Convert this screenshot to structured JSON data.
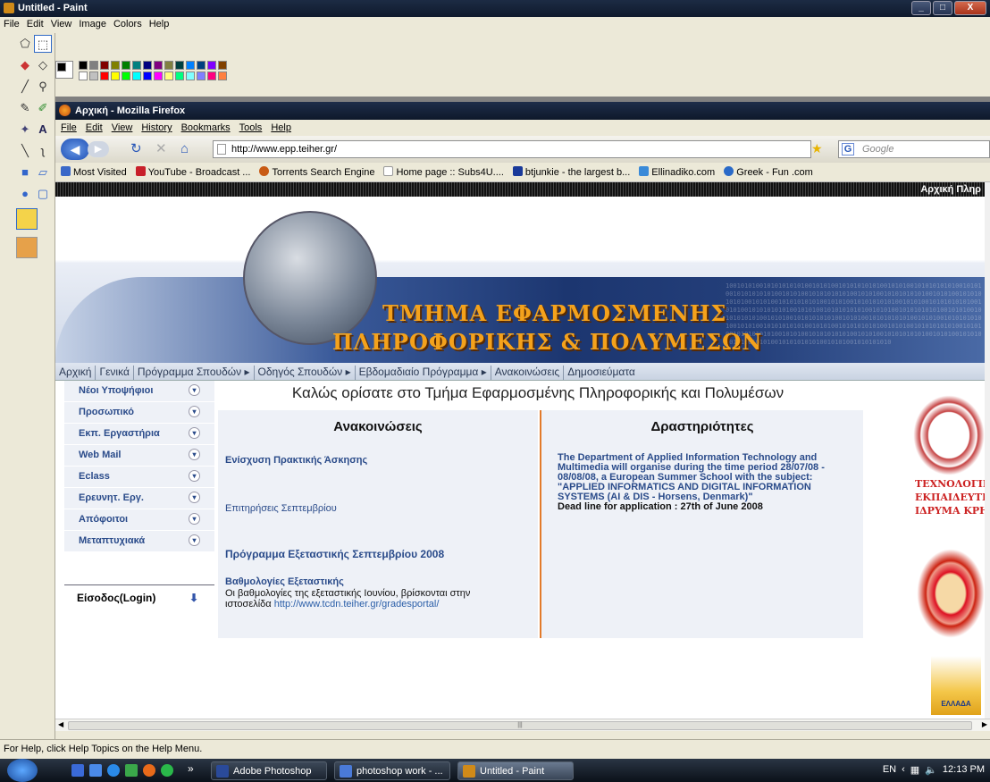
{
  "paint": {
    "title": "Untitled - Paint",
    "menu": [
      "File",
      "Edit",
      "View",
      "Image",
      "Colors",
      "Help"
    ],
    "status": "For Help, click Help Topics on the Help Menu.",
    "palette_top": [
      "#000000",
      "#808080",
      "#800000",
      "#808000",
      "#008000",
      "#008080",
      "#000080",
      "#800080",
      "#808040",
      "#004040",
      "#0080ff",
      "#004080",
      "#8000ff",
      "#804000"
    ],
    "palette_bottom": [
      "#ffffff",
      "#c0c0c0",
      "#ff0000",
      "#ffff00",
      "#00ff00",
      "#00ffff",
      "#0000ff",
      "#ff00ff",
      "#ffff80",
      "#00ff80",
      "#80ffff",
      "#8080ff",
      "#ff0080",
      "#ff8040"
    ]
  },
  "firefox": {
    "title": "Αρχική - Mozilla Firefox",
    "menu": [
      "File",
      "Edit",
      "View",
      "History",
      "Bookmarks",
      "Tools",
      "Help"
    ],
    "url": "http://www.epp.teiher.gr/",
    "search_placeholder": "Google",
    "bookmarks": [
      {
        "label": "Most Visited",
        "color": "#3a68c8"
      },
      {
        "label": "YouTube - Broadcast ...",
        "color": "#c8202a"
      },
      {
        "label": "Torrents Search Engine",
        "color": "#c85a14"
      },
      {
        "label": "Home page :: Subs4U....",
        "color": "#ffffff"
      },
      {
        "label": "btjunkie - the largest b...",
        "color": "#1a3a9a"
      },
      {
        "label": "Ellinadiko.com",
        "color": "#3a8ad8"
      },
      {
        "label": "Greek - Fun .com",
        "color": "#2a6ac8"
      }
    ]
  },
  "site": {
    "top_links": "Αρχική Πληρ",
    "banner_line1": "ΤΜΗΜΑ ΕΦΑΡΜΟΣΜΕΝΗΣ",
    "banner_line2": "ΠΛΗΡΟΦΟΡΙΚΗΣ & ΠΟΛΥΜΕΣΩΝ",
    "nav": [
      "Αρχική",
      "Γενικά",
      "Πρόγραμμα Σπουδών ▸",
      "Οδηγός Σπουδών ▸",
      "Εβδομαδιαίο Πρόγραμμα ▸",
      "Ανακοινώσεις",
      "Δημοσιεύματα"
    ],
    "sidebar": [
      "Νέοι Υποψήφιοι",
      "Προσωπικό",
      "Εκπ. Εργαστήρια",
      "Web Mail",
      "Eclass",
      "Ερευνητ. Εργ.",
      "Απόφοιτοι",
      "Μεταπτυχιακά"
    ],
    "login": "Είσοδος(Login)",
    "welcome": "Καλώς ορίσατε στο Τμήμα Εφαρμοσμένης Πληροφορικής και Πολυμέσων",
    "announcements_title": "Ανακοινώσεις",
    "activities_title": "Δραστηριότητες",
    "announcements": {
      "a1": "Ενίσχυση Πρακτικής Άσκησης",
      "a2": "Επιτηρήσεις Σεπτεμβρίου",
      "a3": "Πρόγραμμα Εξεταστικής Σεπτεμβρίου 2008",
      "a4_title": "Βαθμολογίες Εξεταστικής",
      "a4_text": "Οι βαθμολογίες της εξεταστικής Ιουνίου, βρίσκονται στην ιστοσελίδα",
      "a4_link": "http://www.tcdn.teiher.gr/gradesportal/"
    },
    "activity_text": "The Department of Applied Information Technology and Multimedia will organise during the time period 28/07/08 - 08/08/08, a European Summer School with the subject: \"APPLIED INFORMATICS AND DIGITAL INFORMATION SYSTEMS (AI & DIS - Horsens, Denmark)\"",
    "activity_deadline": "Dead line for application : 27th  of June 2008",
    "logo1_lines": [
      "ΤΕΧΝΟΛΟΓΙΚ",
      "ΕΚΠΑΙΔΕΥΤΙΚ",
      "ΙΔΡΥΜΑ ΚΡΗΤΙ"
    ],
    "logo3_text": "ΕΛΛΑΔΑ"
  },
  "taskbar": {
    "tasks": [
      "Adobe Photoshop",
      "photoshop work - ...",
      "Untitled - Paint"
    ],
    "lang": "EN",
    "time": "12:13 PM"
  }
}
